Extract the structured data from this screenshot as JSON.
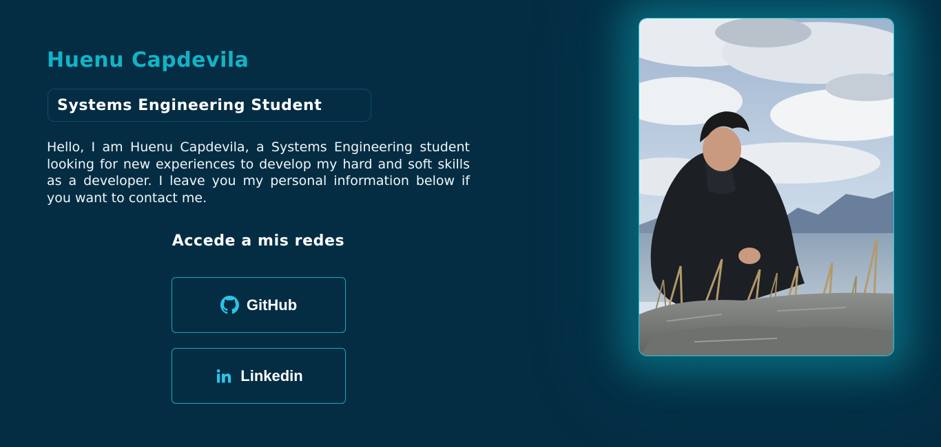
{
  "profile": {
    "name": "Huenu Capdevila",
    "role": "Systems Engineering Student",
    "bio": "Hello, I am Huenu Capdevila, a Systems Engineering student looking for new experiences to develop my hard and soft skills as a developer. I leave you my personal information below if you want to contact me."
  },
  "socials": {
    "title": "Accede a mis redes",
    "links": [
      {
        "label": "GitHub",
        "icon": "github-icon"
      },
      {
        "label": "Linkedin",
        "icon": "linkedin-icon"
      }
    ]
  },
  "photo": {
    "description_icon": "profile-photo"
  },
  "colors": {
    "background": "#042d43",
    "accent": "#13b3c6",
    "icon": "#2bc4e6",
    "text": "#ffffff"
  }
}
